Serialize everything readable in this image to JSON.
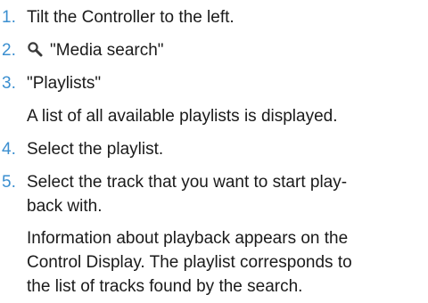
{
  "steps": [
    {
      "number": "1.",
      "text": "Tilt the Controller to the left."
    },
    {
      "number": "2.",
      "icon": "search-icon",
      "text": "\"Media search\""
    },
    {
      "number": "3.",
      "text": "\"Playlists\""
    },
    {
      "number": "4.",
      "text": "Select the playlist."
    },
    {
      "number": "5.",
      "text_line1": "Select the track that you want to start play-",
      "text_line2": "back with."
    }
  ],
  "notes": {
    "after_step3": "A list of all available playlists is displayed.",
    "after_step5_line1": "Information about playback appears on the",
    "after_step5_line2": "Control Display. The playlist corresponds to",
    "after_step5_line3": "the list of tracks found by the search."
  },
  "colors": {
    "step_number": "#3b8fd0",
    "text": "#1a1a1a",
    "background": "#ffffff"
  }
}
